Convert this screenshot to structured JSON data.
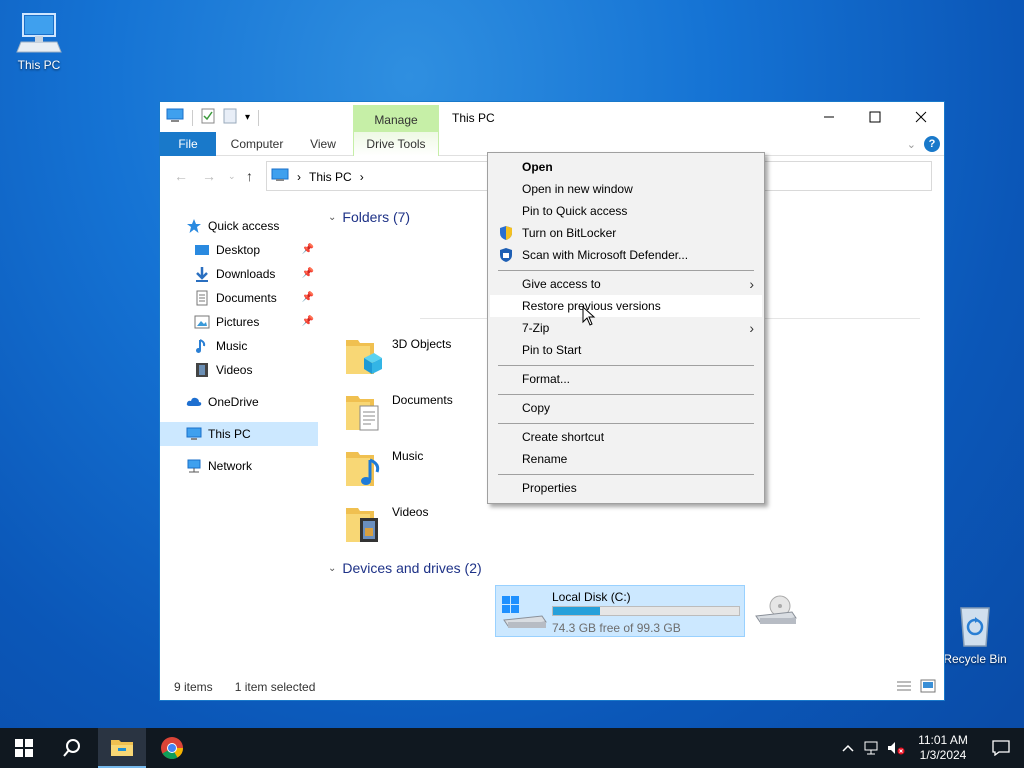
{
  "desktop": {
    "this_pc_label": "This PC",
    "recycle_bin_label": "Recycle Bin"
  },
  "window": {
    "title": "This PC",
    "contextual_tab": "Manage",
    "ribbon_tabs": {
      "file": "File",
      "computer": "Computer",
      "view": "View",
      "drive_tools": "Drive Tools"
    },
    "controls": {
      "minimize": "—",
      "maximize": "☐",
      "close": "✕"
    }
  },
  "address": {
    "path_label": "This PC",
    "separator": "›"
  },
  "nav_pane": {
    "quick_access": "Quick access",
    "desktop": "Desktop",
    "downloads": "Downloads",
    "documents": "Documents",
    "pictures": "Pictures",
    "music": "Music",
    "videos": "Videos",
    "onedrive": "OneDrive",
    "this_pc": "This PC",
    "network": "Network"
  },
  "content": {
    "folders_header": "Folders (7)",
    "folders": {
      "objects3d": "3D Objects",
      "documents": "Documents",
      "music": "Music",
      "videos": "Videos"
    },
    "devices_header": "Devices and drives (2)",
    "drive": {
      "name": "Local Disk (C:)",
      "free_text": "74.3 GB free of 99.3 GB",
      "used_fraction": 0.25
    }
  },
  "status": {
    "item_count": "9 items",
    "selection": "1 item selected"
  },
  "context_menu": {
    "open": "Open",
    "open_new_window": "Open in new window",
    "pin_quick_access": "Pin to Quick access",
    "bitlocker": "Turn on BitLocker",
    "defender": "Scan with Microsoft Defender...",
    "give_access": "Give access to",
    "restore_versions": "Restore previous versions",
    "zip": "7-Zip",
    "pin_start": "Pin to Start",
    "format": "Format...",
    "copy": "Copy",
    "create_shortcut": "Create shortcut",
    "rename": "Rename",
    "properties": "Properties",
    "submenu_arrow": "›"
  },
  "taskbar": {
    "time": "11:01 AM",
    "date": "1/3/2024"
  },
  "colors": {
    "accent": "#1979ca",
    "selection": "#cce8ff",
    "manage_tab": "#c6efa7",
    "drive_bar": "#26a0da",
    "taskbar": "#101820"
  }
}
